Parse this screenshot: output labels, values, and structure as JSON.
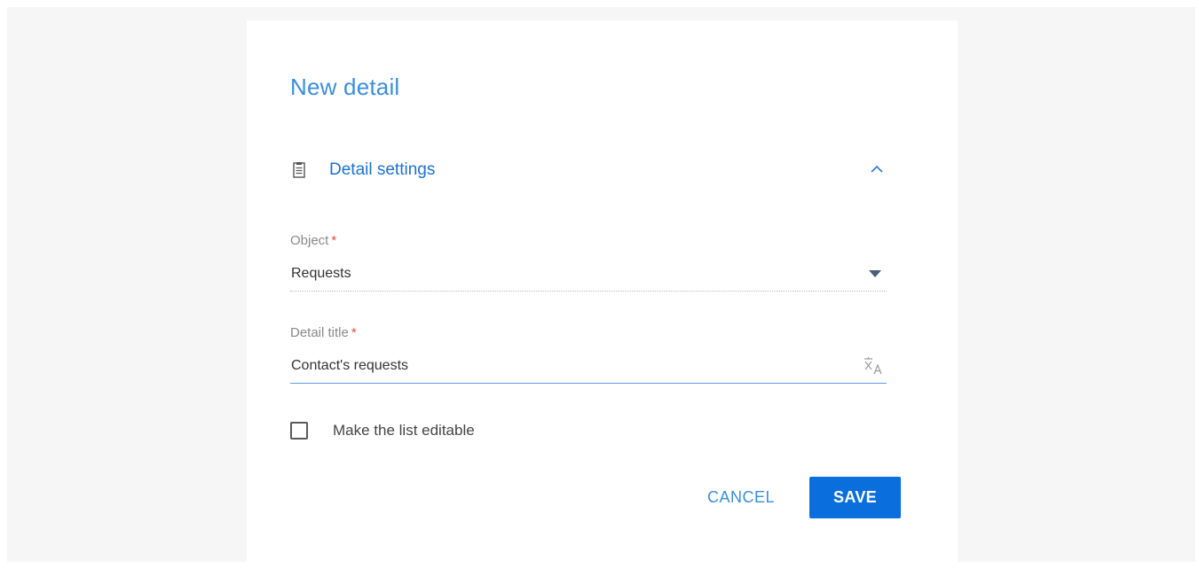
{
  "dialog": {
    "title": "New detail"
  },
  "section": {
    "label": "Detail settings",
    "icon": "document-icon",
    "collapse_icon": "chevron-up-icon"
  },
  "fields": {
    "object": {
      "label": "Object",
      "required_mark": "*",
      "value": "Requests",
      "icon": "dropdown-arrow-icon"
    },
    "detail_title": {
      "label": "Detail title",
      "required_mark": "*",
      "value": "Contact's requests",
      "icon": "translate-icon"
    }
  },
  "checkbox": {
    "label": "Make the list editable",
    "checked": false
  },
  "buttons": {
    "cancel": "CANCEL",
    "save": "SAVE"
  },
  "colors": {
    "accent": "#1a72d6",
    "primary_button": "#0a6fdc",
    "required": "#e24b3b",
    "backdrop": "#f6f6f6"
  }
}
